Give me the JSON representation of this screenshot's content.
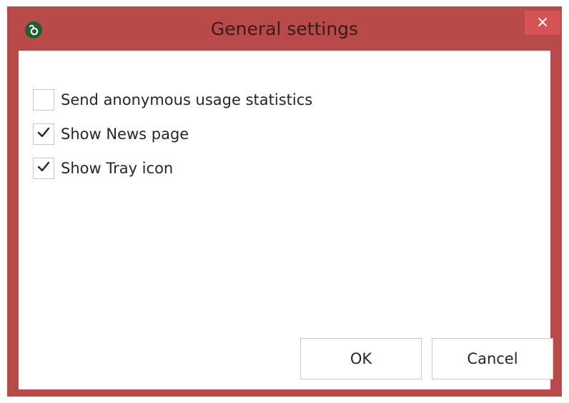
{
  "window": {
    "title": "General settings",
    "app_icon": "app-logo-icon",
    "close_icon": "close-icon",
    "frame_color": "#b94a4a",
    "close_button_color": "#d55353"
  },
  "options": [
    {
      "label": "Send anonymous usage statistics",
      "checked": false
    },
    {
      "label": "Show News page",
      "checked": true
    },
    {
      "label": "Show Tray icon",
      "checked": true
    }
  ],
  "buttons": {
    "ok_label": "OK",
    "cancel_label": "Cancel"
  }
}
